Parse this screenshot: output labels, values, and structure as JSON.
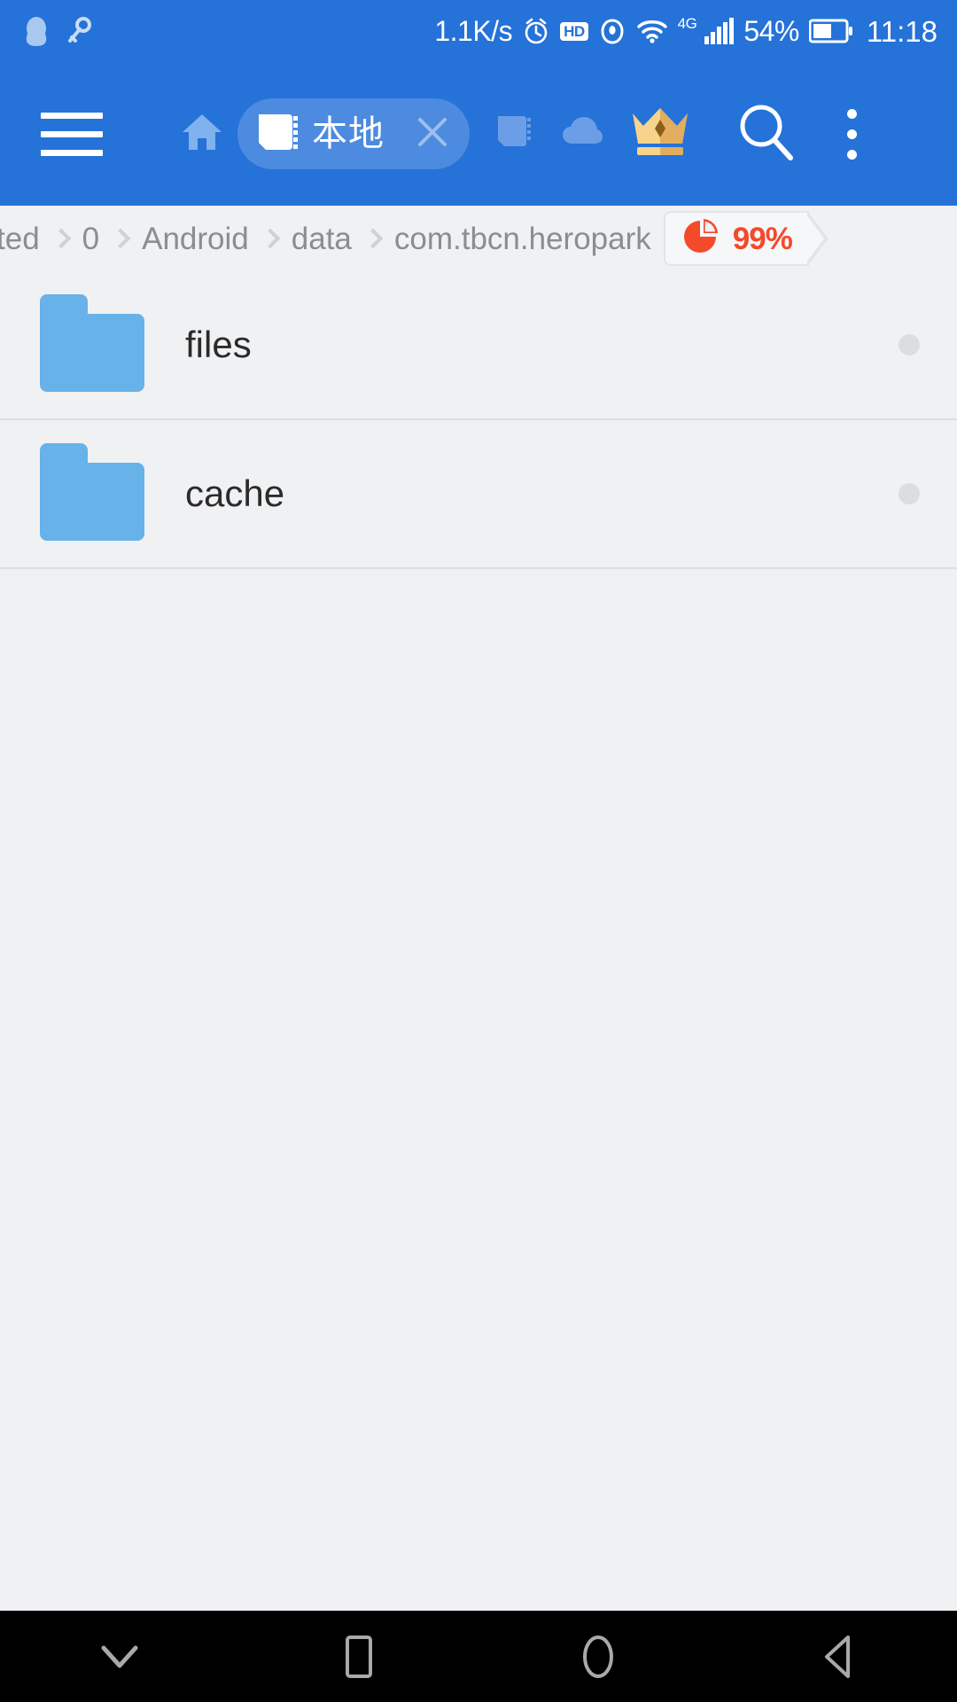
{
  "status_bar": {
    "left_icons": [
      "qq-penguin-icon",
      "key-icon"
    ],
    "network_speed": "1.1K/s",
    "icons": [
      "alarm-clock-icon",
      "hd-icon",
      "eye-icon",
      "wifi-icon",
      "4g-icon",
      "signal-bars-icon"
    ],
    "hd_label": "HD",
    "network_type": "4G",
    "battery_percent": "54%",
    "clock": "11:18",
    "background_color": "#2572d8"
  },
  "toolbar": {
    "menu_icon": "hamburger-menu-icon",
    "home_icon": "home-icon",
    "active_tab": {
      "icon": "sdcard-icon",
      "label": "本地",
      "close_icon": "close-x-icon"
    },
    "sdcard_tab_icon": "sdcard-icon",
    "cloud_tab_icon": "cloud-icon",
    "vip_icon": "crown-icon",
    "search_icon": "search-icon",
    "overflow_icon": "more-vertical-icon",
    "background_color": "#2572d8"
  },
  "breadcrumb": {
    "segments": [
      "ted",
      "0",
      "Android",
      "data",
      "com.tbcn.heropark"
    ],
    "storage": {
      "icon": "pie-chart-icon",
      "percent": "99%",
      "accent_color": "#f4492a"
    }
  },
  "file_list": {
    "items": [
      {
        "icon": "folder-icon",
        "name": "files",
        "indicator": "status-dot"
      },
      {
        "icon": "folder-icon",
        "name": "cache",
        "indicator": "status-dot"
      }
    ],
    "folder_color": "#67b2e8"
  },
  "nav_bar": {
    "buttons": [
      {
        "icon": "chevron-down-icon",
        "name": "hide-keyboard"
      },
      {
        "icon": "square-icon",
        "name": "recents"
      },
      {
        "icon": "circle-icon",
        "name": "home"
      },
      {
        "icon": "triangle-left-icon",
        "name": "back"
      }
    ],
    "background_color": "#000000"
  }
}
